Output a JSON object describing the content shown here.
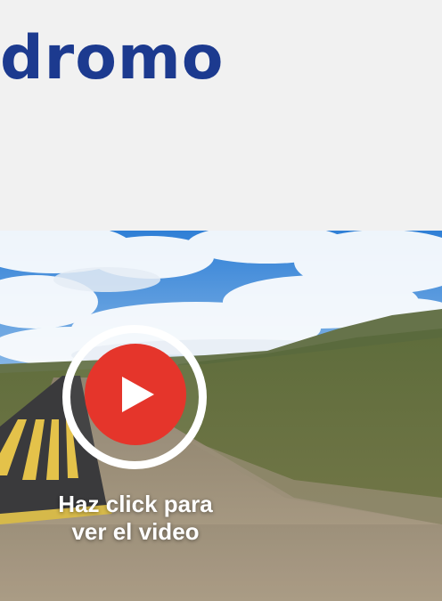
{
  "header": {
    "title": "dromo"
  },
  "video": {
    "caption_line1": "Haz click para",
    "caption_line2": "ver el video",
    "play_icon": "play-icon",
    "colors": {
      "play_button": "#e5352b",
      "ring": "#ffffff",
      "title": "#1c3a8f"
    }
  }
}
